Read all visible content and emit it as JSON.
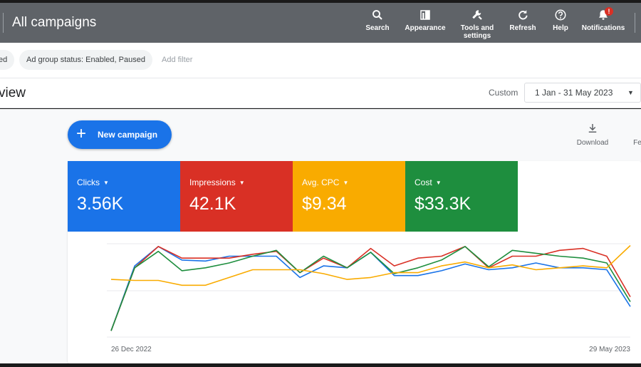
{
  "header": {
    "title": "All campaigns",
    "items": [
      {
        "label": "Search",
        "icon": "search-icon"
      },
      {
        "label": "Appearance",
        "icon": "appearance-icon"
      },
      {
        "label": "Tools and settings",
        "icon": "wrench-icon"
      },
      {
        "label": "Refresh",
        "icon": "refresh-icon"
      },
      {
        "label": "Help",
        "icon": "help-icon"
      },
      {
        "label": "Notifications",
        "icon": "bell-icon",
        "badge": "!"
      }
    ]
  },
  "filters": {
    "chip_partial": "ed",
    "chip_ad_group": "Ad group status: Enabled, Paused",
    "add_filter": "Add filter"
  },
  "overview": {
    "title_partial": "view",
    "date_label": "Custom",
    "date_range": "1 Jan - 31 May 2023"
  },
  "actions": {
    "new_campaign": "New campaign",
    "download": "Download",
    "partial_tool": "Fe"
  },
  "metrics": [
    {
      "label": "Clicks",
      "value": "3.56K",
      "color": "#1a73e8"
    },
    {
      "label": "Impressions",
      "value": "42.1K",
      "color": "#d93025"
    },
    {
      "label": "Avg. CPC",
      "value": "$9.34",
      "color": "#f9ab00"
    },
    {
      "label": "Cost",
      "value": "$33.3K",
      "color": "#1e8e3e"
    }
  ],
  "chart_data": {
    "type": "line",
    "x_start_label": "26 Dec 2022",
    "x_end_label": "29 May 2023",
    "ylim": [
      0,
      100
    ],
    "grid": true,
    "series": [
      {
        "color": "#1a73e8",
        "values": [
          5,
          72,
          92,
          78,
          77,
          82,
          82,
          82,
          60,
          72,
          70,
          86,
          62,
          62,
          67,
          74,
          68,
          70,
          75,
          70,
          70,
          68,
          30
        ]
      },
      {
        "color": "#d93025",
        "values": [
          5,
          70,
          92,
          80,
          80,
          80,
          84,
          87,
          65,
          80,
          70,
          90,
          72,
          80,
          82,
          92,
          70,
          82,
          82,
          88,
          90,
          82,
          40
        ]
      },
      {
        "color": "#1e8e3e",
        "values": [
          5,
          70,
          87,
          67,
          70,
          75,
          82,
          88,
          65,
          82,
          70,
          86,
          64,
          70,
          78,
          92,
          71,
          88,
          85,
          82,
          80,
          75,
          35
        ]
      },
      {
        "color": "#f9ab00",
        "values": [
          58,
          57,
          57,
          52,
          52,
          60,
          68,
          68,
          68,
          64,
          58,
          60,
          65,
          65,
          72,
          76,
          70,
          73,
          68,
          70,
          72,
          70,
          93
        ]
      }
    ]
  }
}
